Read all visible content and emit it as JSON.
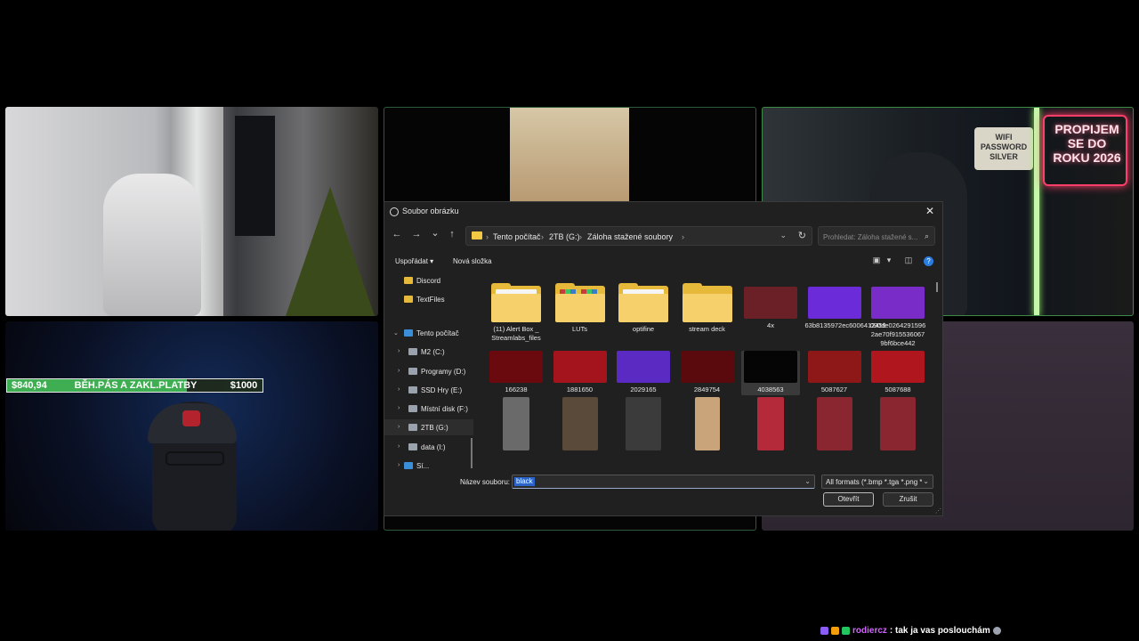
{
  "overlay": {
    "goal": {
      "current": "$840,94",
      "title": "BĚH.PÁS A ZAKL.PLATBY",
      "target": "$1000",
      "progress": 0.84
    },
    "chat": {
      "user": "rodiercz",
      "message": ": tak ja vas poslouchám"
    }
  },
  "cam3": {
    "neon_text": "PROPIJEM SE DO ROKU 2026",
    "sign_text": "WIFI PASSWORD SILVER"
  },
  "dialog": {
    "title": "Soubor obrázku",
    "close": "✕",
    "nav": {
      "back": "←",
      "forward": "→",
      "recent": "⌄",
      "up": "↑"
    },
    "breadcrumb": [
      "Tento počítač",
      "2TB (G:)",
      "Záloha stažené soubory"
    ],
    "search_placeholder": "Prohledat: Záloha stažené s...",
    "toolbar": {
      "organize": "Uspořádat ▾",
      "new_folder": "Nová složka",
      "help": "?"
    },
    "nav_pane": [
      {
        "label": "Discord",
        "type": "folder"
      },
      {
        "label": "TextFiles",
        "type": "folder"
      },
      {
        "label": "Tento počítač",
        "type": "pc",
        "expanded": true
      },
      {
        "label": "M2 (C:)",
        "type": "drive"
      },
      {
        "label": "Programy (D:)",
        "type": "drive"
      },
      {
        "label": "SSD Hry (E:)",
        "type": "drive"
      },
      {
        "label": "Místní disk (F:)",
        "type": "drive"
      },
      {
        "label": "2TB (G:)",
        "type": "drive",
        "selected": true
      },
      {
        "label": "data (I:)",
        "type": "drive"
      },
      {
        "label": "Sí...",
        "type": "network"
      }
    ],
    "files": [
      {
        "name": "(11) Alert Box _ Streamlabs_files",
        "kind": "folder-doc",
        "color": "#e7b93a"
      },
      {
        "name": "LUTs",
        "kind": "folder-grid",
        "color": "#e7b93a"
      },
      {
        "name": "optifine",
        "kind": "folder-doc",
        "color": "#e7b93a"
      },
      {
        "name": "stream deck",
        "kind": "folder",
        "color": "#e7b93a"
      },
      {
        "name": "4x",
        "kind": "image",
        "color": "#6b1f26"
      },
      {
        "name": "63b8135972ec6006412459",
        "kind": "image",
        "color": "#6c2bd9"
      },
      {
        "name": "090de0264291596 2ae70f915536067 9bf6bce442",
        "kind": "image",
        "color": "#7a2cc9"
      },
      {
        "name": "166238",
        "kind": "image",
        "color": "#6b0a0e"
      },
      {
        "name": "1881650",
        "kind": "image",
        "color": "#a4141c"
      },
      {
        "name": "2029165",
        "kind": "image",
        "color": "#5b2ac2"
      },
      {
        "name": "2849754",
        "kind": "image",
        "color": "#5a0a0c"
      },
      {
        "name": "4038563",
        "kind": "image",
        "color": "#050505",
        "selected": true
      },
      {
        "name": "5087627",
        "kind": "image",
        "color": "#8e1818"
      },
      {
        "name": "5087688",
        "kind": "image",
        "color": "#b0161e"
      },
      {
        "name": "",
        "kind": "image",
        "color": "#6a6a6a"
      },
      {
        "name": "",
        "kind": "image",
        "color": "#5a4a3a"
      },
      {
        "name": "",
        "kind": "image",
        "color": "#3b3b3b"
      },
      {
        "name": "",
        "kind": "image",
        "color": "#c9a37a"
      },
      {
        "name": "",
        "kind": "image",
        "color": "#b52a3a"
      },
      {
        "name": "",
        "kind": "image",
        "color": "#8a2630"
      },
      {
        "name": "",
        "kind": "image",
        "color": "#8a2630"
      }
    ],
    "filename_label": "Název souboru:",
    "filename_value": "black",
    "filetype": "All formats (*.bmp *.tga *.png *",
    "open_button": "Otevřít",
    "cancel_button": "Zrušit"
  }
}
